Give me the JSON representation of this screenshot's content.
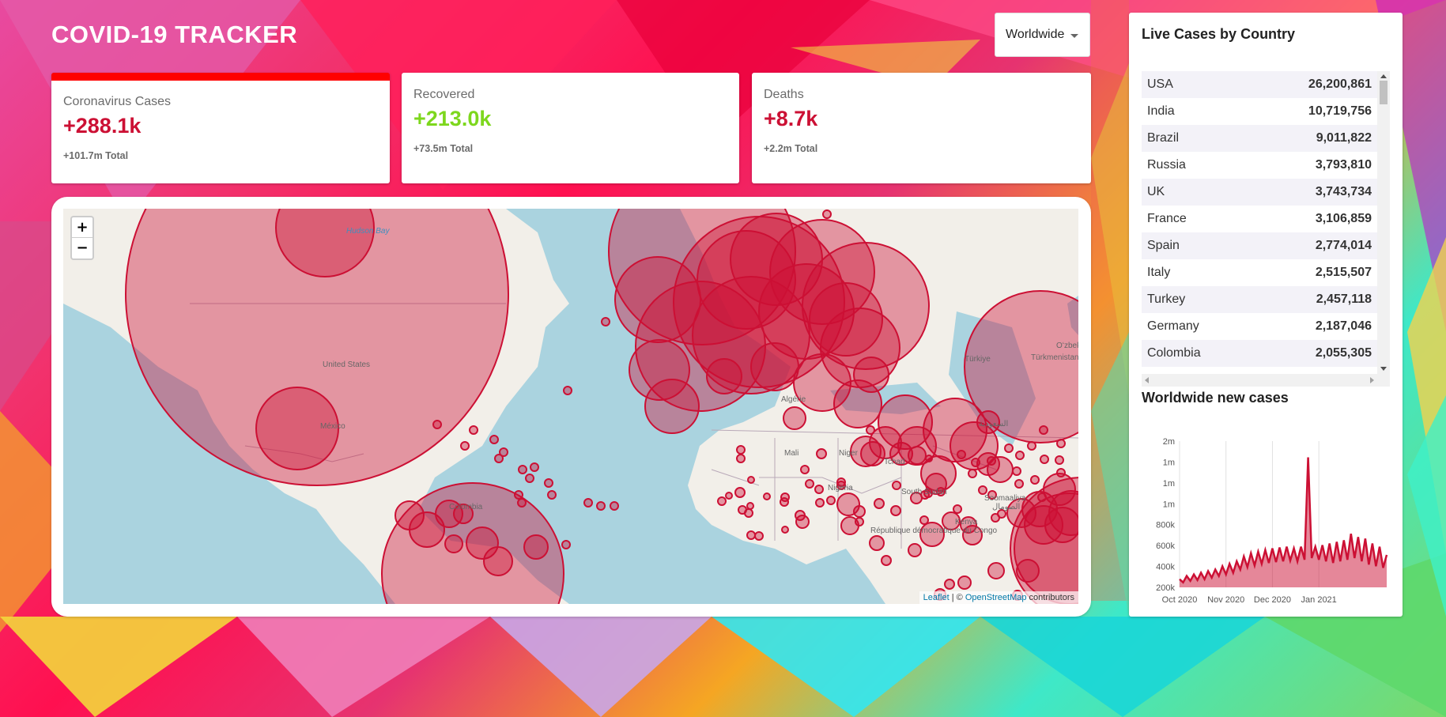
{
  "app": {
    "title": "COVID-19 TRACKER"
  },
  "country_select": {
    "selected": "Worldwide"
  },
  "cards": [
    {
      "label": "Coronavirus Cases",
      "value": "+288.1k",
      "total": "+101.7m Total",
      "color": "#cc1034",
      "active": true
    },
    {
      "label": "Recovered",
      "value": "+213.0k",
      "total": "+73.5m Total",
      "color": "#7dd71d",
      "active": false
    },
    {
      "label": "Deaths",
      "value": "+8.7k",
      "total": "+2.2m Total",
      "color": "#cc1034",
      "active": false
    }
  ],
  "map": {
    "zoom_in": "+",
    "zoom_out": "−",
    "attribution": {
      "leaflet": "Leaflet",
      "sep": " | © ",
      "osm": "OpenStreetMap",
      "tail": " contributors"
    },
    "labels": [
      "United States",
      "México",
      "Colombia",
      "Mali",
      "Niger",
      "Tchad",
      "Nigeria",
      "South Sudan",
      "Soomaaliya",
      "الصومال",
      "Kenya",
      "République démocratique du Congo",
      "Türkiye",
      "Türkmenistan",
      "Hudson Bay",
      "Algérie",
      "السعودية",
      "Oʻzbekiston"
    ],
    "circle_color": "#cc1034"
  },
  "sidebar": {
    "table_title": "Live Cases by Country",
    "countries": [
      {
        "country": "USA",
        "cases": "26,200,861"
      },
      {
        "country": "India",
        "cases": "10,719,756"
      },
      {
        "country": "Brazil",
        "cases": "9,011,822"
      },
      {
        "country": "Russia",
        "cases": "3,793,810"
      },
      {
        "country": "UK",
        "cases": "3,743,734"
      },
      {
        "country": "France",
        "cases": "3,106,859"
      },
      {
        "country": "Spain",
        "cases": "2,774,014"
      },
      {
        "country": "Italy",
        "cases": "2,515,507"
      },
      {
        "country": "Turkey",
        "cases": "2,457,118"
      },
      {
        "country": "Germany",
        "cases": "2,187,046"
      },
      {
        "country": "Colombia",
        "cases": "2,055,305"
      }
    ],
    "chart_title": "Worldwide new cases"
  },
  "chart_data": {
    "type": "area",
    "title": "Worldwide new cases",
    "xlabel": "",
    "ylabel": "",
    "y_tick_labels": [
      "2m",
      "1m",
      "1m",
      "1m",
      "800k",
      "600k",
      "400k",
      "200k"
    ],
    "y_ticks": [
      2000000,
      1800000,
      1600000,
      1400000,
      800000,
      600000,
      400000,
      200000
    ],
    "x_tick_labels": [
      "Oct 2020",
      "Nov 2020",
      "Dec 2020",
      "Jan 2021"
    ],
    "ylim": [
      200000,
      2000000
    ],
    "color": "#cc1034",
    "fill": "rgba(204,16,52,0.5)",
    "grid": "vertical",
    "series": [
      {
        "values": [
          300000,
          260000,
          340000,
          280000,
          360000,
          290000,
          380000,
          300000,
          400000,
          320000,
          420000,
          340000,
          460000,
          360000,
          490000,
          380000,
          520000,
          420000,
          580000,
          450000,
          620000,
          470000,
          640000,
          490000,
          660000,
          500000,
          680000,
          510000,
          690000,
          520000,
          700000,
          530000,
          680000,
          520000,
          700000,
          540000,
          1800000,
          560000,
          700000,
          540000,
          720000,
          520000,
          740000,
          500000,
          760000,
          520000,
          780000,
          540000,
          860000,
          560000,
          820000,
          520000,
          800000,
          480000,
          740000,
          460000,
          700000,
          440000,
          600000
        ]
      }
    ]
  }
}
